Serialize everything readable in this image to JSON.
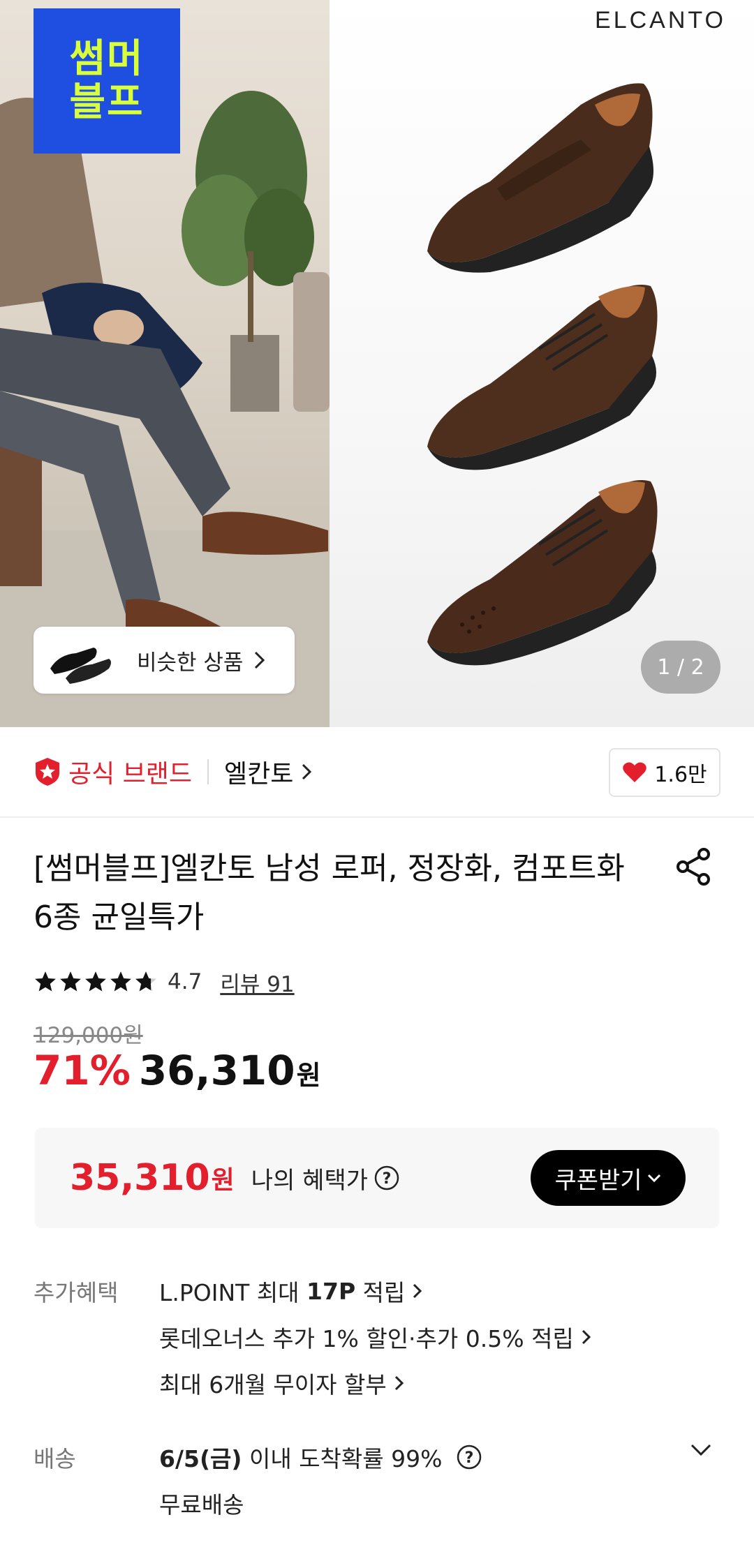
{
  "hero": {
    "promo_badge": [
      "썸머",
      "블프"
    ],
    "brand_logo": "ELCANTO",
    "similar_label": "비슷한 상품",
    "page_indicator": "1 / 2"
  },
  "brand_row": {
    "official_label": "공식 브랜드",
    "brand_name": "엘칸토",
    "like_count": "1.6만"
  },
  "product": {
    "title": "[썸머블프]엘칸토 남성 로퍼, 정장화, 컴포트화 6종 균일특가",
    "rating": "4.7",
    "star_rating": 4.7,
    "review_link": "리뷰 91",
    "original_price": "129,000원",
    "discount": "71%",
    "price": "36,310",
    "price_unit": "원"
  },
  "benefit_box": {
    "price": "35,310",
    "price_unit": "원",
    "label": "나의 혜택가",
    "coupon_button": "쿠폰받기"
  },
  "extra_benefits": {
    "label": "추가혜택",
    "lpoint_prefix": "L.POINT 최대 ",
    "lpoint_points": "17P",
    "lpoint_suffix": " 적립",
    "card_line": "롯데오너스 추가 1% 할인·추가 0.5% 적립",
    "installment_line": "최대 6개월 무이자 할부"
  },
  "delivery": {
    "label": "배송",
    "date": "6/5(금)",
    "probability": " 이내 도착확률 99%",
    "fee": "무료배송"
  },
  "colors": {
    "accent_red": "#e31e2d",
    "promo_blue": "#1f4fe0",
    "promo_lime": "#d9ff3a"
  }
}
